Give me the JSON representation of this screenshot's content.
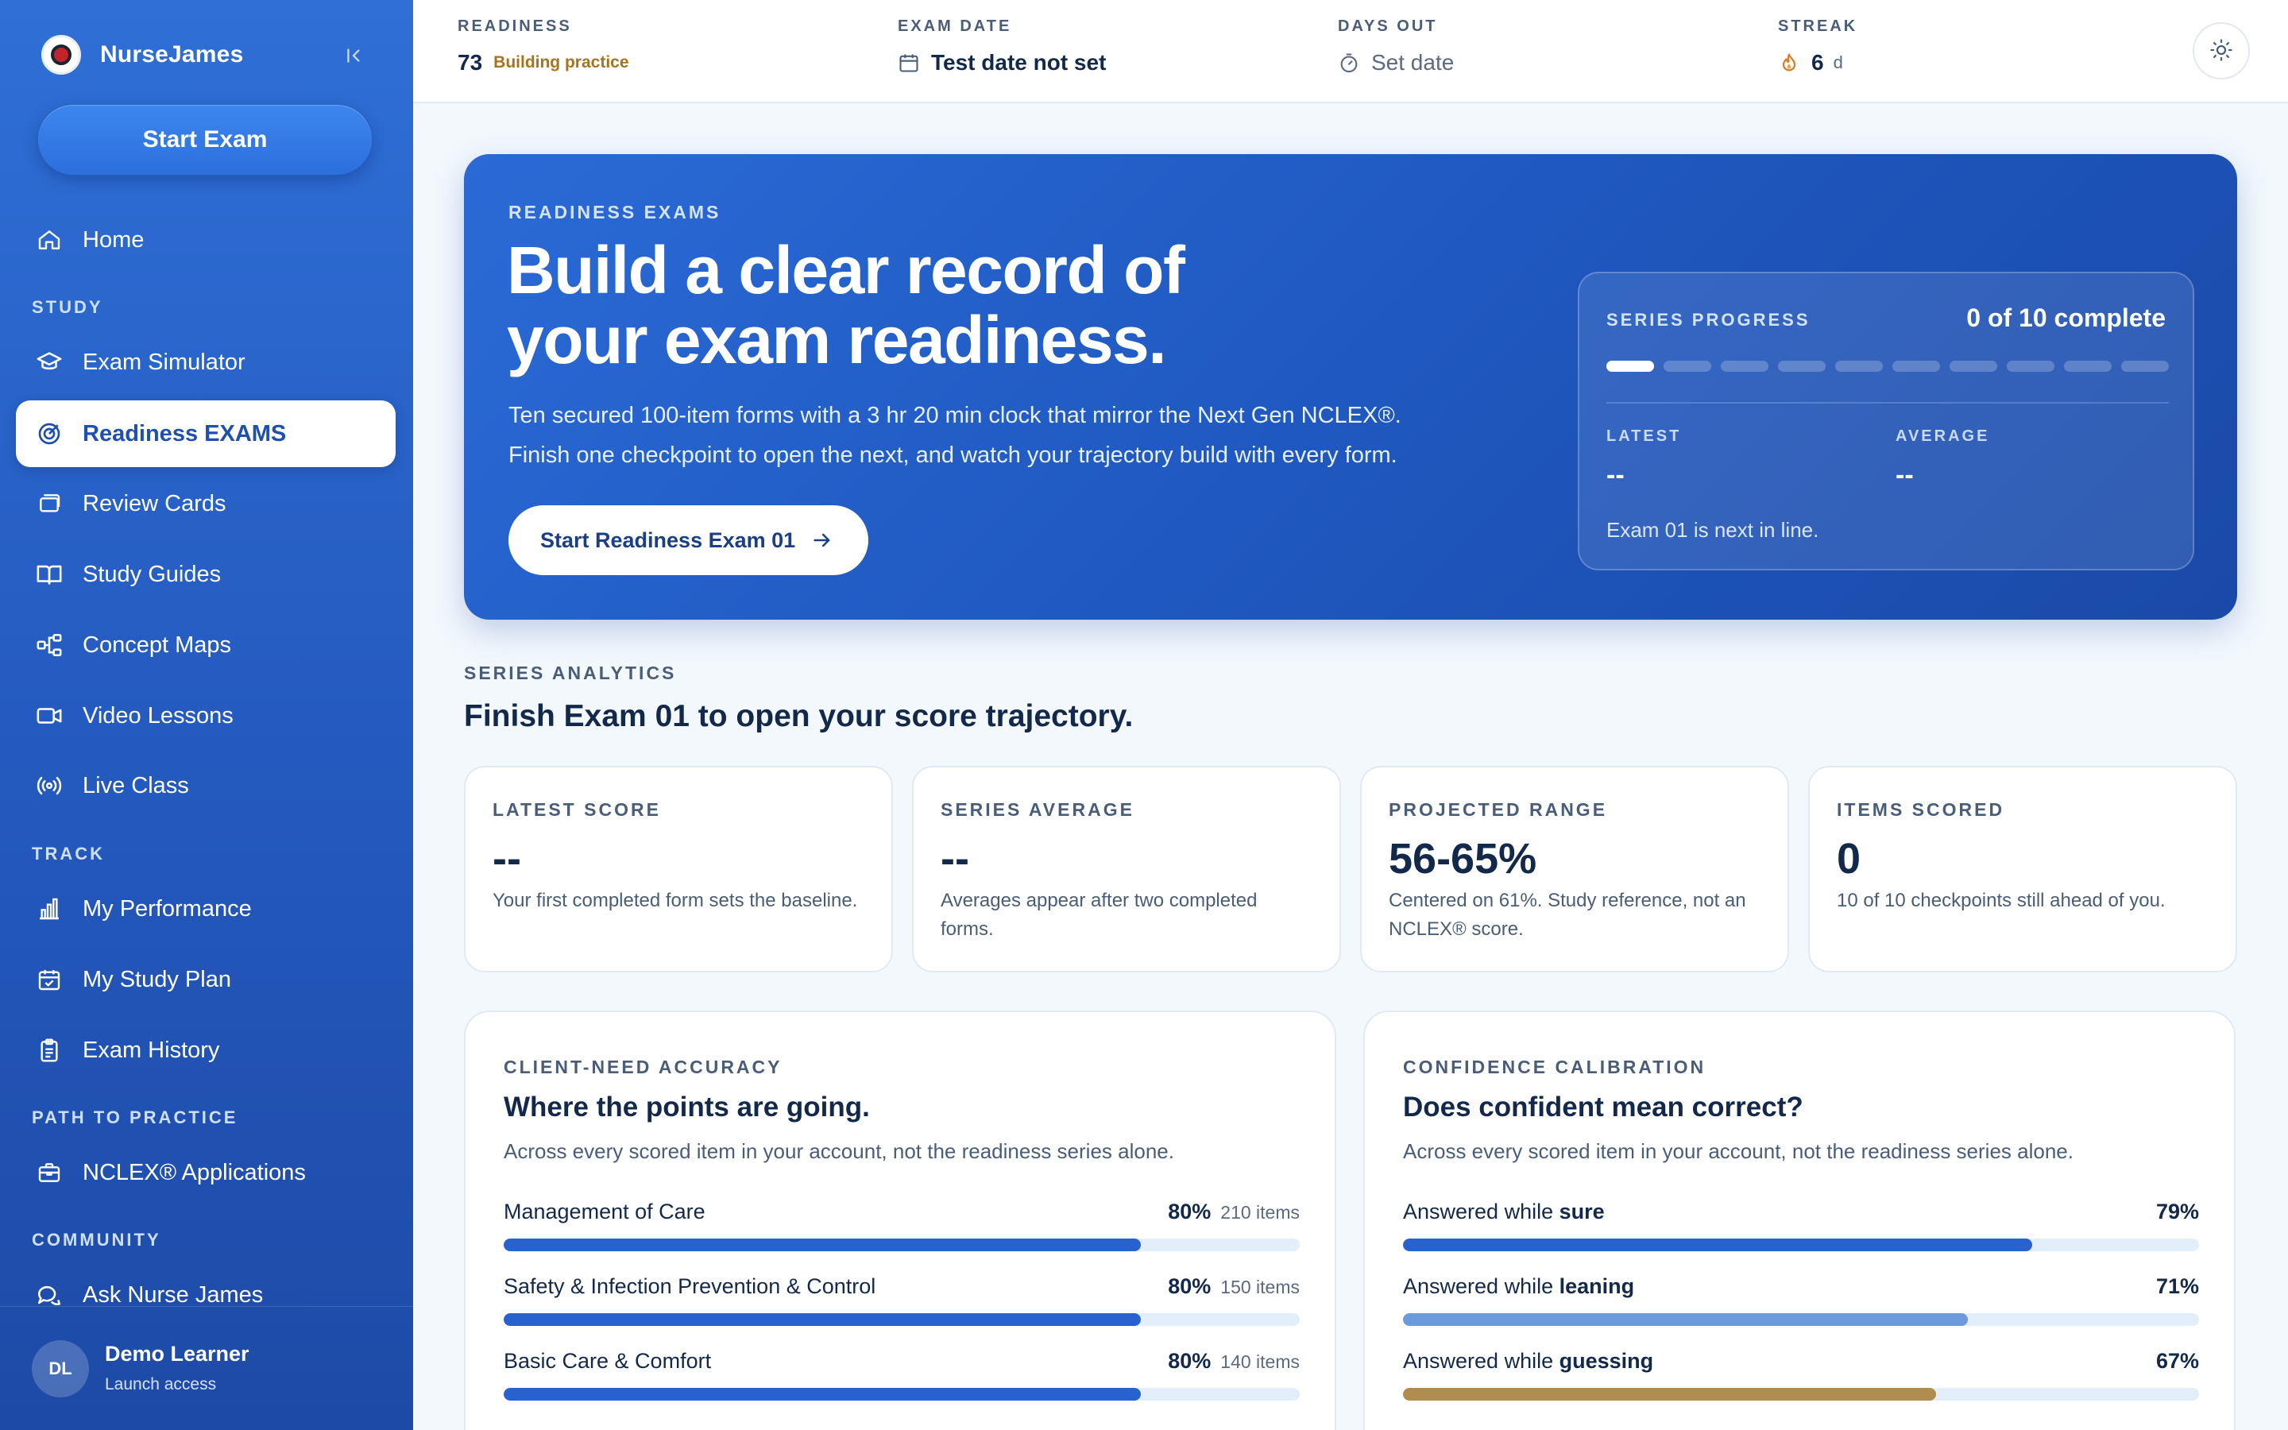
{
  "brand": {
    "name": "NurseJames"
  },
  "sidebar": {
    "start_exam": "Start Exam",
    "items": [
      {
        "label": "Home",
        "icon": "home-icon"
      },
      {
        "label": "Exam Simulator",
        "icon": "graduation-cap-icon"
      },
      {
        "label": "Readiness EXAMS",
        "icon": "target-icon",
        "active": true
      },
      {
        "label": "Review Cards",
        "icon": "cards-icon"
      },
      {
        "label": "Study Guides",
        "icon": "book-open-icon"
      },
      {
        "label": "Concept Maps",
        "icon": "network-icon"
      },
      {
        "label": "Video Lessons",
        "icon": "video-icon"
      },
      {
        "label": "Live Class",
        "icon": "broadcast-icon"
      },
      {
        "label": "My Performance",
        "icon": "bar-chart-icon"
      },
      {
        "label": "My Study Plan",
        "icon": "calendar-check-icon"
      },
      {
        "label": "Exam History",
        "icon": "clipboard-icon"
      },
      {
        "label": "NCLEX® Applications",
        "icon": "briefcase-icon"
      },
      {
        "label": "Ask Nurse James",
        "icon": "chat-icon"
      }
    ],
    "sections": {
      "study": "STUDY",
      "track": "TRACK",
      "path": "PATH TO PRACTICE",
      "community": "COMMUNITY"
    },
    "user": {
      "initials": "DL",
      "name": "Demo Learner",
      "access": "Launch access"
    }
  },
  "topbar": {
    "readiness": {
      "label": "READINESS",
      "value": "73",
      "tag": "Building practice"
    },
    "exam_date": {
      "label": "EXAM DATE",
      "value": "Test date not set"
    },
    "days_out": {
      "label": "DAYS OUT",
      "value": "Set date"
    },
    "streak": {
      "label": "STREAK",
      "value": "6",
      "unit": "d"
    }
  },
  "hero": {
    "eyebrow": "READINESS EXAMS",
    "title": "Build a clear record of your exam readiness.",
    "desc_line1": "Ten secured 100-item forms with a 3 hr 20 min clock that mirror the Next Gen NCLEX®.",
    "desc_line2": "Finish one checkpoint to open the next, and watch your trajectory build with every form.",
    "button": "Start Readiness Exam 01",
    "progress": {
      "label": "SERIES PROGRESS",
      "count": "0 of 10 complete",
      "total": 10,
      "completed": 1,
      "latest_label": "LATEST",
      "latest_value": "--",
      "average_label": "AVERAGE",
      "average_value": "--",
      "next": "Exam 01 is next in line."
    }
  },
  "analytics": {
    "eyebrow": "SERIES ANALYTICS",
    "title": "Finish Exam 01 to open your score trajectory.",
    "metrics": [
      {
        "label": "LATEST SCORE",
        "value": "--",
        "desc": "Your first completed form sets the baseline."
      },
      {
        "label": "SERIES AVERAGE",
        "value": "--",
        "desc": "Averages appear after two completed forms."
      },
      {
        "label": "PROJECTED RANGE",
        "value": "56-65%",
        "desc": "Centered on 61%. Study reference, not an NCLEX® score."
      },
      {
        "label": "ITEMS SCORED",
        "value": "0",
        "desc": "10 of 10 checkpoints still ahead of you."
      }
    ]
  },
  "client_need": {
    "eyebrow": "CLIENT-NEED ACCURACY",
    "title": "Where the points are going.",
    "desc": "Across every scored item in your account, not the readiness series alone.",
    "rows": [
      {
        "label": "Management of Care",
        "pct": "80%",
        "items": "210 items",
        "value": 0.8
      },
      {
        "label": "Safety & Infection Prevention & Control",
        "pct": "80%",
        "items": "150 items",
        "value": 0.8
      },
      {
        "label": "Basic Care & Comfort",
        "pct": "80%",
        "items": "140 items",
        "value": 0.8
      }
    ]
  },
  "confidence": {
    "eyebrow": "CONFIDENCE CALIBRATION",
    "title": "Does confident mean correct?",
    "desc": "Across every scored item in your account, not the readiness series alone.",
    "prefix": "Answered while",
    "rows": [
      {
        "word": "sure",
        "pct": "79%",
        "value": 0.79,
        "color": "#2762cf"
      },
      {
        "word": "leaning",
        "pct": "71%",
        "value": 0.71,
        "color": "#6d99dd"
      },
      {
        "word": "guessing",
        "pct": "67%",
        "value": 0.67,
        "color": "#b08c4f"
      }
    ]
  }
}
